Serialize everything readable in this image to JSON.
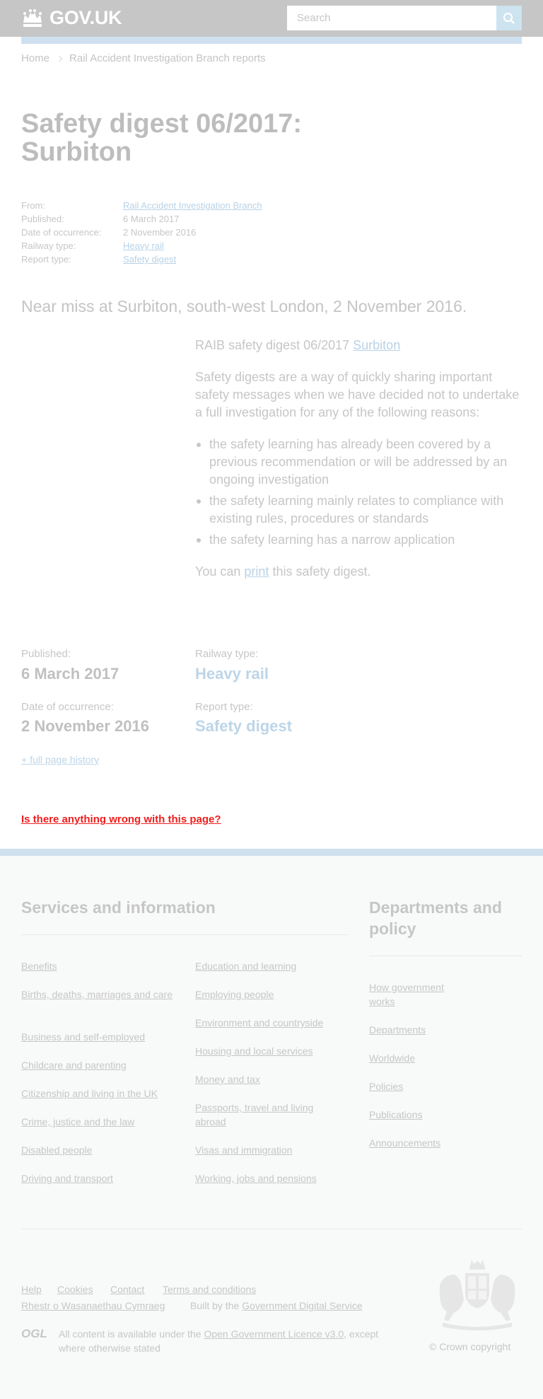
{
  "header": {
    "logo_text": "GOV.UK",
    "search_placeholder": "Search"
  },
  "breadcrumb": {
    "home": "Home",
    "section": "Rail Accident Investigation Branch reports"
  },
  "page_title": "Safety digest 06/2017: Surbiton",
  "metadata": {
    "from_label": "From:",
    "from_value": "Rail Accident Investigation Branch",
    "published_label": "Published:",
    "published_value": "6 March 2017",
    "occurrence_label": "Date of occurrence:",
    "occurrence_value": "2 November 2016",
    "railway_label": "Railway type:",
    "railway_value": "Heavy rail",
    "report_label": "Report type:",
    "report_value": "Safety digest"
  },
  "lead": "Near miss at Surbiton, south-west London, 2 November 2016.",
  "body": {
    "digest_prefix": "RAIB safety digest 06/2017",
    "digest_link": "Surbiton",
    "intro": "Safety digests are a way of quickly sharing important safety messages when we have decided not to undertake a full investigation for any of the following reasons:",
    "bullets": [
      "the safety learning has already been covered by a previous recommendation or will be addressed by an ongoing investigation",
      "the safety learning mainly relates to compliance with existing rules, procedures or standards",
      "the safety learning has a narrow application"
    ],
    "print_prefix": "You can",
    "print_link": "print",
    "print_suffix": "this safety digest."
  },
  "bottom_meta": {
    "published_label": "Published:",
    "published_value": "6 March 2017",
    "railway_label": "Railway type:",
    "railway_value": "Heavy rail",
    "occurrence_label": "Date of occurrence:",
    "occurrence_value": "2 November 2016",
    "report_label": "Report type:",
    "report_value": "Safety digest",
    "history_link": "+ full page history"
  },
  "report_problem": "Is there anything wrong with this page?",
  "footer": {
    "services_heading": "Services and information",
    "departments_heading": "Departments and policy",
    "services_col1": [
      "Benefits",
      "Births, deaths, marriages and care",
      "Business and self-employed",
      "Childcare and parenting",
      "Citizenship and living in the UK",
      "Crime, justice and the law",
      "Disabled people",
      "Driving and transport"
    ],
    "services_col2": [
      "Education and learning",
      "Employing people",
      "Environment and countryside",
      "Housing and local services",
      "Money and tax",
      "Passports, travel and living abroad",
      "Visas and immigration",
      "Working, jobs and pensions"
    ],
    "departments": [
      "How government works",
      "Departments",
      "Worldwide",
      "Policies",
      "Publications",
      "Announcements"
    ],
    "meta_links": [
      "Help",
      "Cookies",
      "Contact",
      "Terms and conditions"
    ],
    "welsh_link": "Rhestr o Wasanaethau Cymraeg",
    "built_by": "Built by the",
    "gds_link": "Government Digital Service",
    "ogl_logo": "OGL",
    "licence_prefix": "All content is available under the",
    "licence_link": "Open Government Licence v3.0",
    "licence_suffix": ", except where otherwise stated",
    "copyright": "© Crown copyright"
  }
}
